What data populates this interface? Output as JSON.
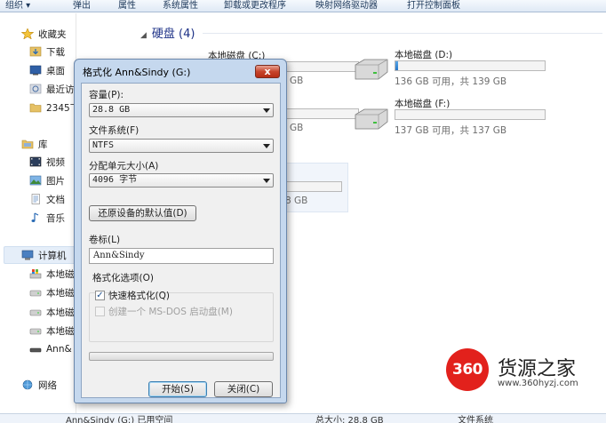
{
  "toolbar": {
    "items": [
      "组织 ▾",
      "弹出",
      "属性",
      "系统属性",
      "卸载或更改程序",
      "映射网络驱动器",
      "打开控制面板"
    ]
  },
  "nav": {
    "favorites": "收藏夹",
    "downloads": "下载",
    "desktop": "桌面",
    "recent": "最近访",
    "item2345": "2345下",
    "library": "库",
    "videos": "视频",
    "pictures": "图片",
    "documents": "文档",
    "music": "音乐",
    "computer": "计算机",
    "disk1": "本地磁",
    "disk2": "本地磁",
    "disk3": "本地磁",
    "disk4": "本地磁",
    "ann": "Ann&",
    "network": "网络"
  },
  "content": {
    "section_title": "硬盘 (4)",
    "drives": [
      {
        "name": "本地磁盘 (C:)",
        "stats": "GB",
        "fill": 0.0
      },
      {
        "name": "本地磁盘 (D:)",
        "stats": "136 GB 可用，共 139 GB",
        "fill": 0.02
      },
      {
        "name": "本地磁盘 (F:)",
        "stats": "137 GB 可用，共 137 GB",
        "fill": 0.0
      },
      {
        "name": "",
        "stats": "GB",
        "fill": 0.0
      },
      {
        "name": "",
        "stats": "8 GB",
        "fill": 0.0
      }
    ]
  },
  "status": {
    "left": "Ann&Sindy (G:) 已用空间",
    "mid": "总大小: 28.8 GB",
    "right": "文件系统"
  },
  "dialog": {
    "title": "格式化 Ann&Sindy (G:)",
    "close": "x",
    "capacity_label": "容量(P):",
    "capacity_value": "28.8 GB",
    "fs_label": "文件系统(F)",
    "fs_value": "NTFS",
    "alloc_label": "分配单元大小(A)",
    "alloc_value": "4096 字节",
    "restore_button": "还原设备的默认值(D)",
    "volume_label": "卷标(L)",
    "volume_value": "Ann&Sindy",
    "options_label": "格式化选项(O)",
    "quick_format": "快速格式化(Q)",
    "quick_format_checked": true,
    "msdos": "创建一个 MS-DOS 启动盘(M)",
    "msdos_checked": false,
    "start_button": "开始(S)",
    "close_button": "关闭(C)",
    "progress": 0.0
  },
  "watermark": {
    "badge": "360",
    "title": "货源之家",
    "url": "www.360hyzj.com"
  },
  "colors": {
    "accent": "#2677c8",
    "watermark_red": "#e2211c",
    "dialog_frame": "#c5d8ee"
  }
}
